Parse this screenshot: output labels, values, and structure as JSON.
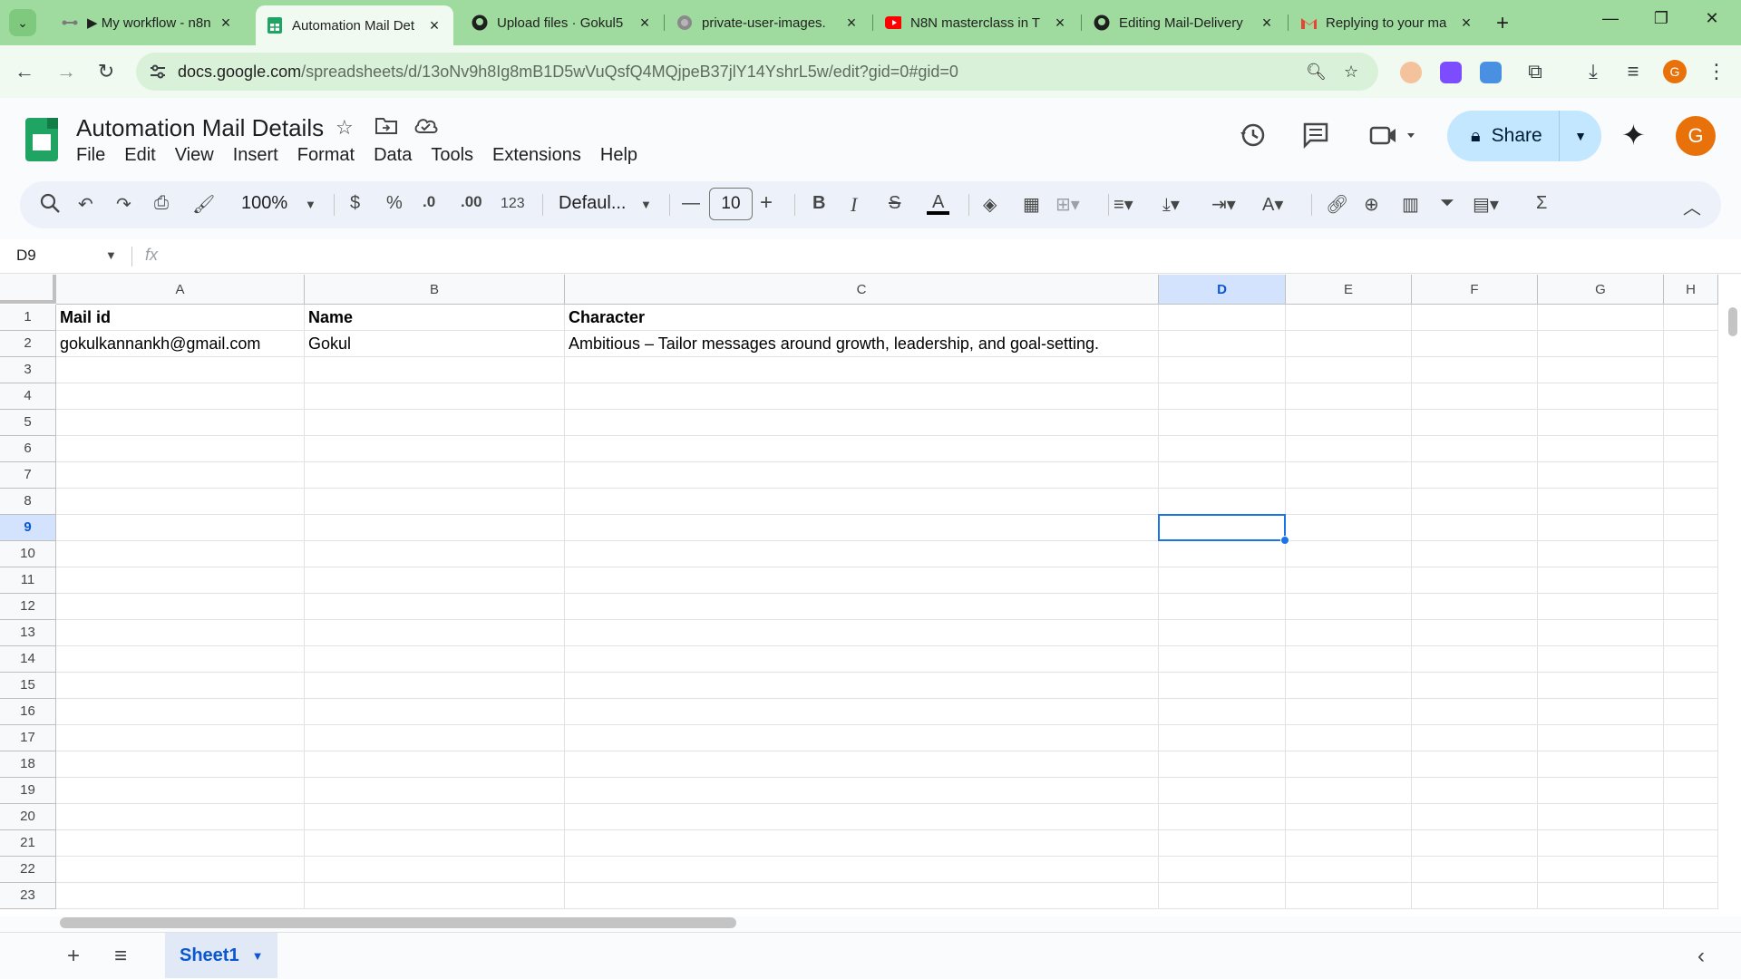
{
  "browser": {
    "tabs": [
      {
        "title": "▶ My workflow - n8n",
        "icon": "n8n-icon"
      },
      {
        "title": "Automation Mail Det",
        "icon": "sheets-icon",
        "active": true
      },
      {
        "title": "Upload files · Gokul5",
        "icon": "github-icon"
      },
      {
        "title": "private-user-images.",
        "icon": "globe-icon"
      },
      {
        "title": "N8N masterclass in T",
        "icon": "youtube-icon"
      },
      {
        "title": "Editing Mail-Delivery",
        "icon": "github-icon"
      },
      {
        "title": "Replying to your ma",
        "icon": "gmail-icon"
      }
    ],
    "url_host": "docs.google.com",
    "url_path": "/spreadsheets/d/13oNv9h8Ig8mB1D5wVuQsfQ4MQjpeB37jlY14YshrL5w/edit?gid=0#gid=0",
    "profile_initial": "G",
    "tabstrip_color": "#9fdb9f"
  },
  "doc": {
    "title": "Automation Mail Details",
    "menu": [
      "File",
      "Edit",
      "View",
      "Insert",
      "Format",
      "Data",
      "Tools",
      "Extensions",
      "Help"
    ],
    "share_label": "Share",
    "avatar_initial": "G"
  },
  "toolbar": {
    "zoom": "100%",
    "currency": "$",
    "percent": "%",
    "dec_decrease": ".0",
    "dec_increase": ".00",
    "number_format": "123",
    "font": "Defaul...",
    "font_size": "10",
    "bold": "B",
    "italic": "I",
    "strike": "S",
    "text_color": "A"
  },
  "formula_bar": {
    "name_box": "D9",
    "fx": "fx",
    "value": ""
  },
  "sheet": {
    "columns": [
      "A",
      "B",
      "C",
      "D",
      "E",
      "F",
      "G",
      "H"
    ],
    "selected_column": "D",
    "rows": [
      "1",
      "2",
      "3",
      "4",
      "5",
      "6",
      "7",
      "8",
      "9",
      "10",
      "11",
      "12",
      "13",
      "14",
      "15",
      "16",
      "17",
      "18",
      "19",
      "20",
      "21",
      "22",
      "23"
    ],
    "selected_row": "9",
    "cells": {
      "A1": "Mail id",
      "B1": "Name",
      "C1": "Character",
      "A2": "gokulkannankh@gmail.com",
      "B2": "Gokul",
      "C2": "Ambitious – Tailor messages around growth, leadership, and goal-setting."
    },
    "selected_cell": "D9",
    "tab_name": "Sheet1"
  }
}
